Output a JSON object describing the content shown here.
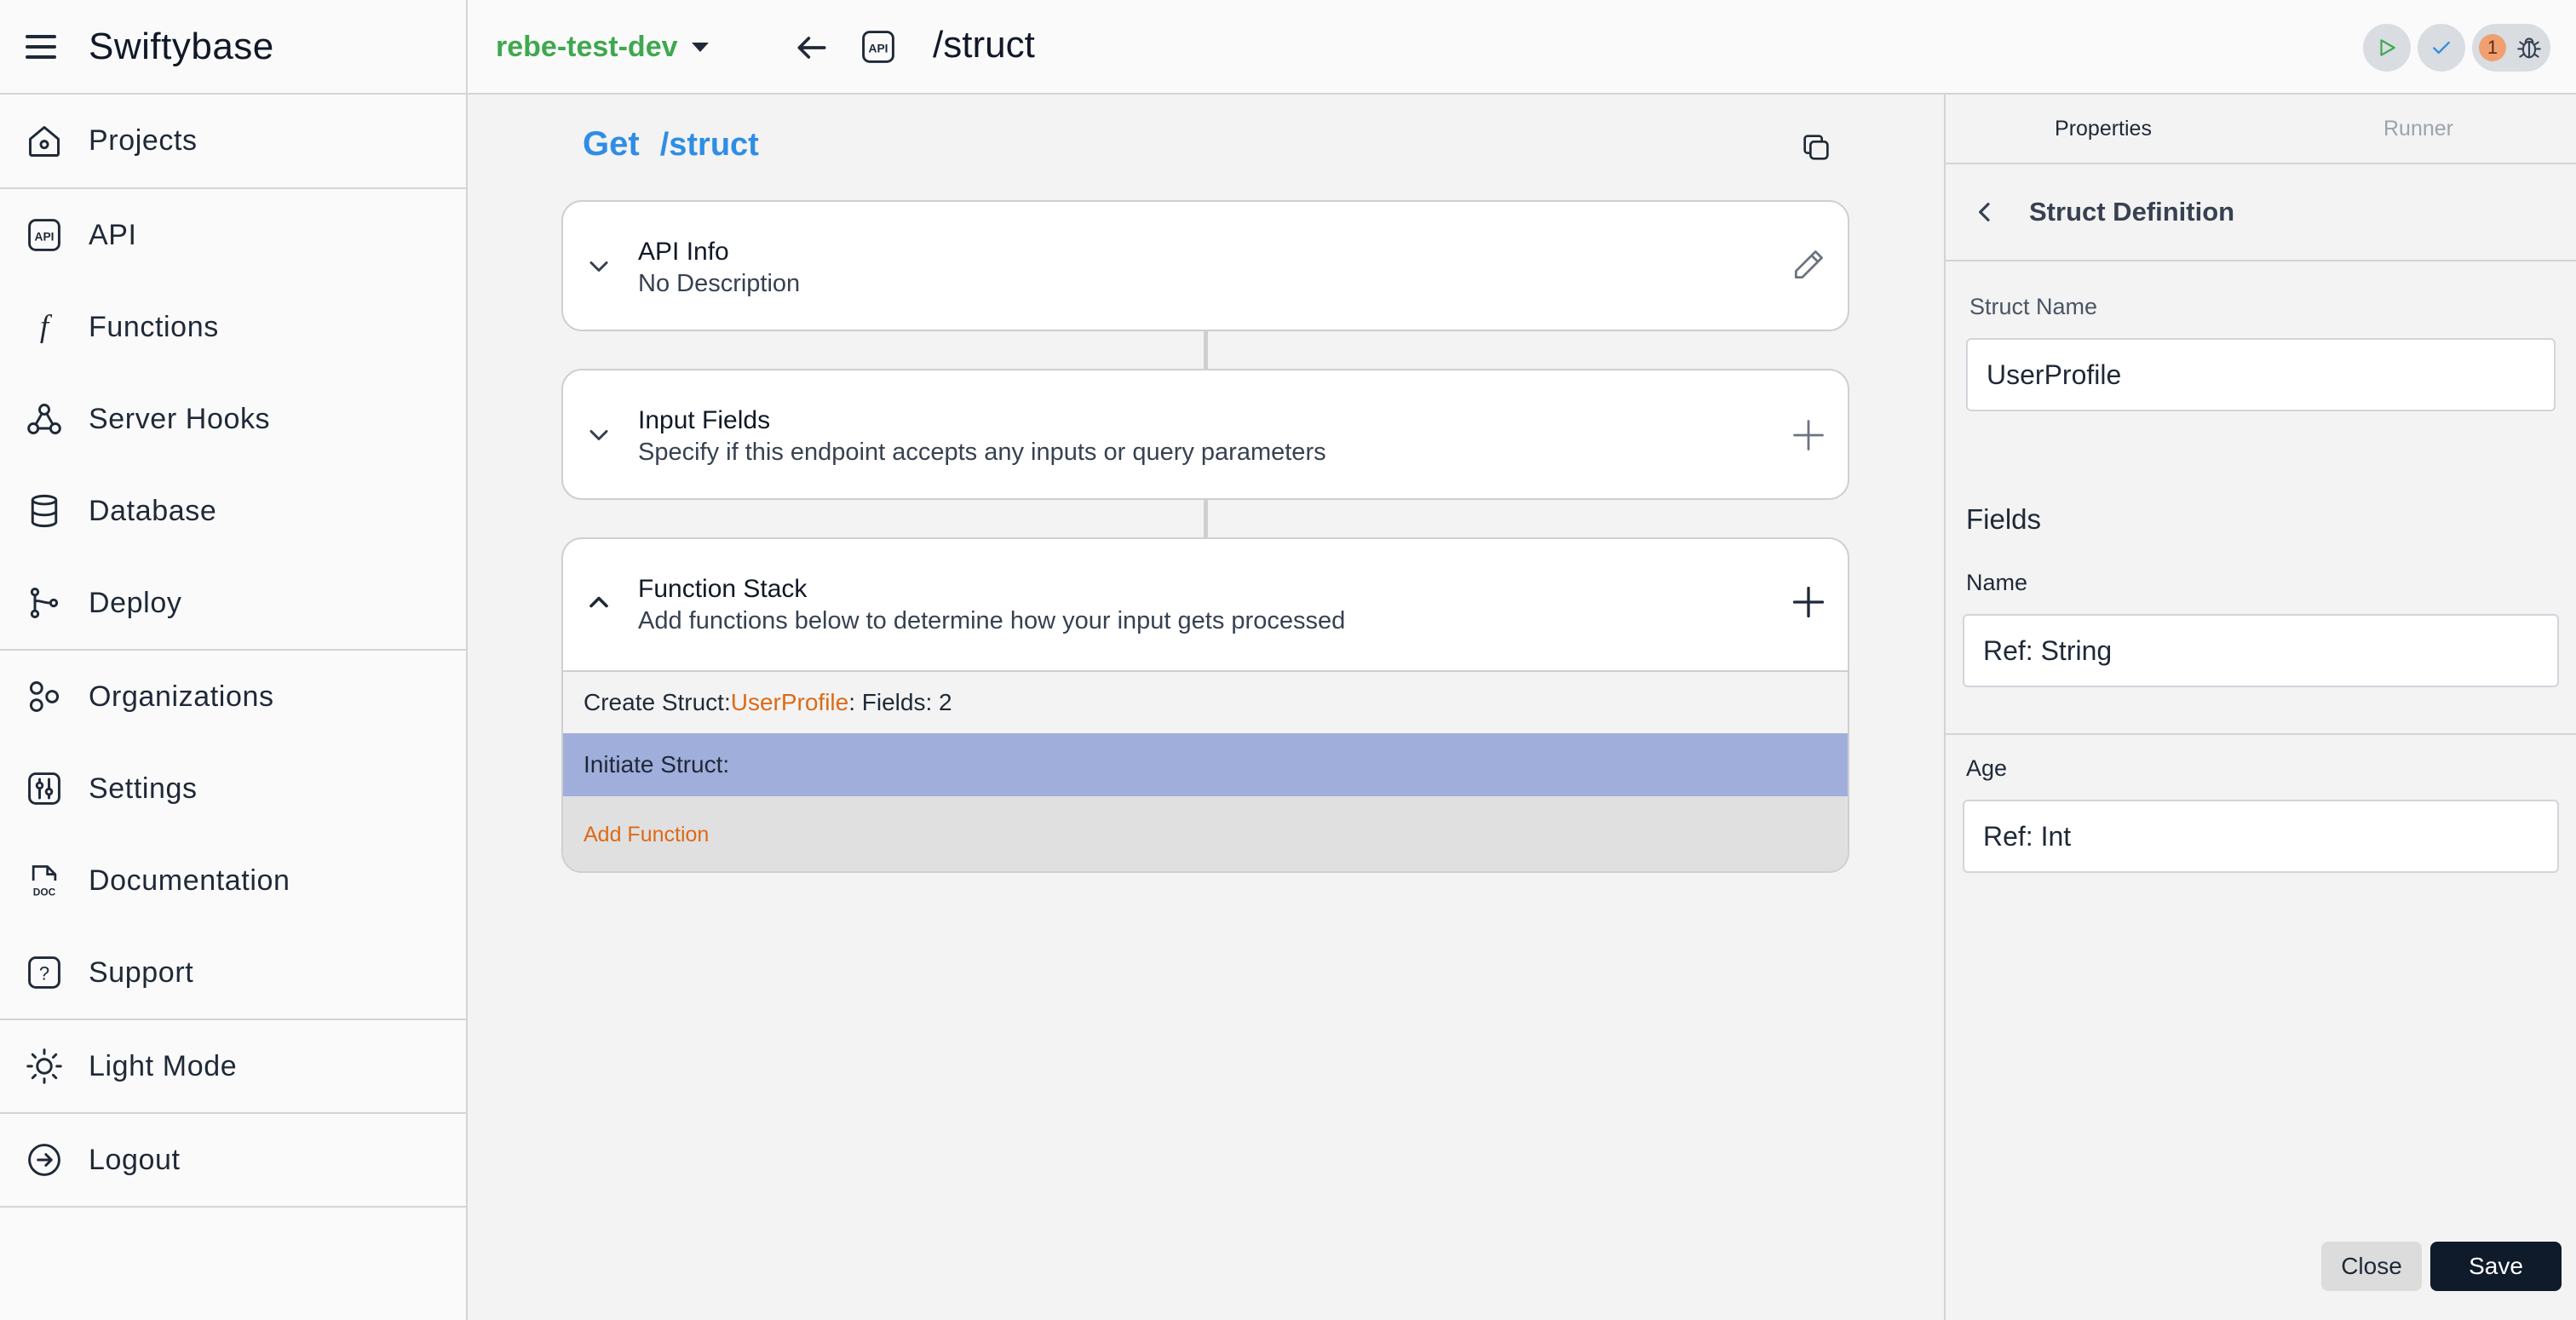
{
  "app": {
    "name": "Swiftybase"
  },
  "sidebar": {
    "items": [
      {
        "label": "Projects",
        "icon": "home-icon"
      },
      {
        "label": "API",
        "icon": "api-icon"
      },
      {
        "label": "Functions",
        "icon": "function-icon"
      },
      {
        "label": "Server Hooks",
        "icon": "webhook-icon"
      },
      {
        "label": "Database",
        "icon": "database-icon"
      },
      {
        "label": "Deploy",
        "icon": "deploy-icon"
      },
      {
        "label": "Organizations",
        "icon": "organizations-icon"
      },
      {
        "label": "Settings",
        "icon": "settings-icon"
      },
      {
        "label": "Documentation",
        "icon": "doc-icon"
      },
      {
        "label": "Support",
        "icon": "help-icon"
      },
      {
        "label": "Light Mode",
        "icon": "sun-icon"
      },
      {
        "label": "Logout",
        "icon": "logout-icon"
      }
    ]
  },
  "topbar": {
    "environment": "rebe-test-dev",
    "api_badge": "API",
    "path": "/struct",
    "issue_count": "1"
  },
  "endpoint": {
    "method": "Get",
    "path": "/struct"
  },
  "cards": {
    "api_info": {
      "title": "API Info",
      "subtitle": "No Description"
    },
    "input_fields": {
      "title": "Input Fields",
      "subtitle": "Specify if this endpoint accepts any inputs or query parameters"
    },
    "function_stack": {
      "title": "Function Stack",
      "subtitle": "Add functions below to determine how your input gets processed",
      "rows": {
        "create_prefix": "Create Struct: ",
        "create_name": "UserProfile",
        "create_suffix": ": Fields: 2",
        "initiate": "Initiate Struct:",
        "add": "Add Function"
      }
    }
  },
  "panel": {
    "tabs": [
      "Properties",
      "Runner"
    ],
    "header": "Struct Definition",
    "struct_name_label": "Struct Name",
    "struct_name_value": "UserProfile",
    "fields_title": "Fields",
    "fields": [
      {
        "label": "Name",
        "value": "Ref: String"
      },
      {
        "label": "Age",
        "value": "Ref: Int"
      }
    ],
    "close_label": "Close",
    "save_label": "Save"
  },
  "colors": {
    "accent_blue": "#2f8de4",
    "env_green": "#3ea84f",
    "highlight_row": "#a0aedc",
    "orange": "#dd6a16"
  }
}
